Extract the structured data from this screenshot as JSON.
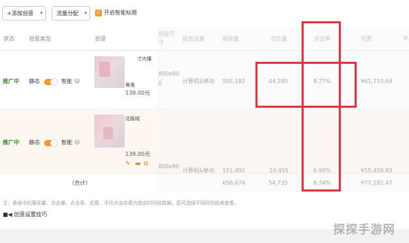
{
  "toolbar": {
    "add_creative": "+添加创意",
    "traffic_split": "流量分配",
    "smart_title_checkbox": "✓",
    "smart_title_label": "开启智能标题"
  },
  "table": {
    "headers": {
      "status": "状态",
      "creative_type": "创意类型",
      "creative": "创意",
      "creative_size": "创意尺寸",
      "device": "投放设备",
      "impressions": "展现量",
      "clicks": "点击量",
      "ctr": "点击率",
      "spend": "花费",
      "extra": "平"
    },
    "rows": [
      {
        "status": "推广中",
        "type_static": "静态",
        "type_smart": "智能",
        "creative_text_a": "寸内懂",
        "creative_text_b": "角堆",
        "creative_price": "139.00元",
        "size_a": "800x80",
        "size_b": "0",
        "device": "计算机&移动",
        "impressions": "505,182",
        "clicks": "44,280",
        "ctr": "8.77%",
        "spend": "¥61,733.64"
      },
      {
        "status": "推广中",
        "type_static": "静态",
        "type_smart": "智能",
        "creative_text_a": "北极绒",
        "creative_text_b": "",
        "creative_price": "139.00元",
        "size_a": "800x80",
        "size_b": "0",
        "device": "计算机&移动",
        "impressions": "151,492",
        "clicks": "10,455",
        "ctr": "6.90%",
        "spend": "¥15,458.83"
      }
    ],
    "total": {
      "label": "（合计）",
      "impressions": "656,674",
      "clicks": "54,735",
      "ctr": "8.34%",
      "spend": "¥77,192.47"
    }
  },
  "note": "注：表格中的展现量、点击量、点击率、花费、平均点击花费为指定时间段数据，您可选择不同时间段来查看。",
  "tips": "■◀ 创意设置技巧",
  "watermark": "探探手游网",
  "colors": {
    "highlight": "#e0343a",
    "accent": "#f29a2e",
    "status": "#3b8a2a"
  }
}
